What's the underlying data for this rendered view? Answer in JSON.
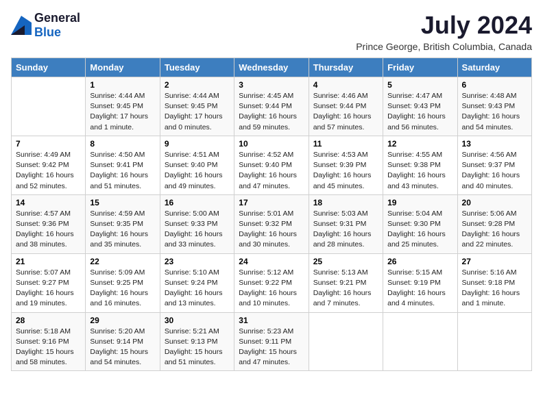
{
  "logo": {
    "text_general": "General",
    "text_blue": "Blue"
  },
  "header": {
    "month_year": "July 2024",
    "location": "Prince George, British Columbia, Canada"
  },
  "days_of_week": [
    "Sunday",
    "Monday",
    "Tuesday",
    "Wednesday",
    "Thursday",
    "Friday",
    "Saturday"
  ],
  "weeks": [
    [
      {
        "day": "",
        "content": ""
      },
      {
        "day": "1",
        "content": "Sunrise: 4:44 AM\nSunset: 9:45 PM\nDaylight: 17 hours\nand 1 minute."
      },
      {
        "day": "2",
        "content": "Sunrise: 4:44 AM\nSunset: 9:45 PM\nDaylight: 17 hours\nand 0 minutes."
      },
      {
        "day": "3",
        "content": "Sunrise: 4:45 AM\nSunset: 9:44 PM\nDaylight: 16 hours\nand 59 minutes."
      },
      {
        "day": "4",
        "content": "Sunrise: 4:46 AM\nSunset: 9:44 PM\nDaylight: 16 hours\nand 57 minutes."
      },
      {
        "day": "5",
        "content": "Sunrise: 4:47 AM\nSunset: 9:43 PM\nDaylight: 16 hours\nand 56 minutes."
      },
      {
        "day": "6",
        "content": "Sunrise: 4:48 AM\nSunset: 9:43 PM\nDaylight: 16 hours\nand 54 minutes."
      }
    ],
    [
      {
        "day": "7",
        "content": "Sunrise: 4:49 AM\nSunset: 9:42 PM\nDaylight: 16 hours\nand 52 minutes."
      },
      {
        "day": "8",
        "content": "Sunrise: 4:50 AM\nSunset: 9:41 PM\nDaylight: 16 hours\nand 51 minutes."
      },
      {
        "day": "9",
        "content": "Sunrise: 4:51 AM\nSunset: 9:40 PM\nDaylight: 16 hours\nand 49 minutes."
      },
      {
        "day": "10",
        "content": "Sunrise: 4:52 AM\nSunset: 9:40 PM\nDaylight: 16 hours\nand 47 minutes."
      },
      {
        "day": "11",
        "content": "Sunrise: 4:53 AM\nSunset: 9:39 PM\nDaylight: 16 hours\nand 45 minutes."
      },
      {
        "day": "12",
        "content": "Sunrise: 4:55 AM\nSunset: 9:38 PM\nDaylight: 16 hours\nand 43 minutes."
      },
      {
        "day": "13",
        "content": "Sunrise: 4:56 AM\nSunset: 9:37 PM\nDaylight: 16 hours\nand 40 minutes."
      }
    ],
    [
      {
        "day": "14",
        "content": "Sunrise: 4:57 AM\nSunset: 9:36 PM\nDaylight: 16 hours\nand 38 minutes."
      },
      {
        "day": "15",
        "content": "Sunrise: 4:59 AM\nSunset: 9:35 PM\nDaylight: 16 hours\nand 35 minutes."
      },
      {
        "day": "16",
        "content": "Sunrise: 5:00 AM\nSunset: 9:33 PM\nDaylight: 16 hours\nand 33 minutes."
      },
      {
        "day": "17",
        "content": "Sunrise: 5:01 AM\nSunset: 9:32 PM\nDaylight: 16 hours\nand 30 minutes."
      },
      {
        "day": "18",
        "content": "Sunrise: 5:03 AM\nSunset: 9:31 PM\nDaylight: 16 hours\nand 28 minutes."
      },
      {
        "day": "19",
        "content": "Sunrise: 5:04 AM\nSunset: 9:30 PM\nDaylight: 16 hours\nand 25 minutes."
      },
      {
        "day": "20",
        "content": "Sunrise: 5:06 AM\nSunset: 9:28 PM\nDaylight: 16 hours\nand 22 minutes."
      }
    ],
    [
      {
        "day": "21",
        "content": "Sunrise: 5:07 AM\nSunset: 9:27 PM\nDaylight: 16 hours\nand 19 minutes."
      },
      {
        "day": "22",
        "content": "Sunrise: 5:09 AM\nSunset: 9:25 PM\nDaylight: 16 hours\nand 16 minutes."
      },
      {
        "day": "23",
        "content": "Sunrise: 5:10 AM\nSunset: 9:24 PM\nDaylight: 16 hours\nand 13 minutes."
      },
      {
        "day": "24",
        "content": "Sunrise: 5:12 AM\nSunset: 9:22 PM\nDaylight: 16 hours\nand 10 minutes."
      },
      {
        "day": "25",
        "content": "Sunrise: 5:13 AM\nSunset: 9:21 PM\nDaylight: 16 hours\nand 7 minutes."
      },
      {
        "day": "26",
        "content": "Sunrise: 5:15 AM\nSunset: 9:19 PM\nDaylight: 16 hours\nand 4 minutes."
      },
      {
        "day": "27",
        "content": "Sunrise: 5:16 AM\nSunset: 9:18 PM\nDaylight: 16 hours\nand 1 minute."
      }
    ],
    [
      {
        "day": "28",
        "content": "Sunrise: 5:18 AM\nSunset: 9:16 PM\nDaylight: 15 hours\nand 58 minutes."
      },
      {
        "day": "29",
        "content": "Sunrise: 5:20 AM\nSunset: 9:14 PM\nDaylight: 15 hours\nand 54 minutes."
      },
      {
        "day": "30",
        "content": "Sunrise: 5:21 AM\nSunset: 9:13 PM\nDaylight: 15 hours\nand 51 minutes."
      },
      {
        "day": "31",
        "content": "Sunrise: 5:23 AM\nSunset: 9:11 PM\nDaylight: 15 hours\nand 47 minutes."
      },
      {
        "day": "",
        "content": ""
      },
      {
        "day": "",
        "content": ""
      },
      {
        "day": "",
        "content": ""
      }
    ]
  ]
}
